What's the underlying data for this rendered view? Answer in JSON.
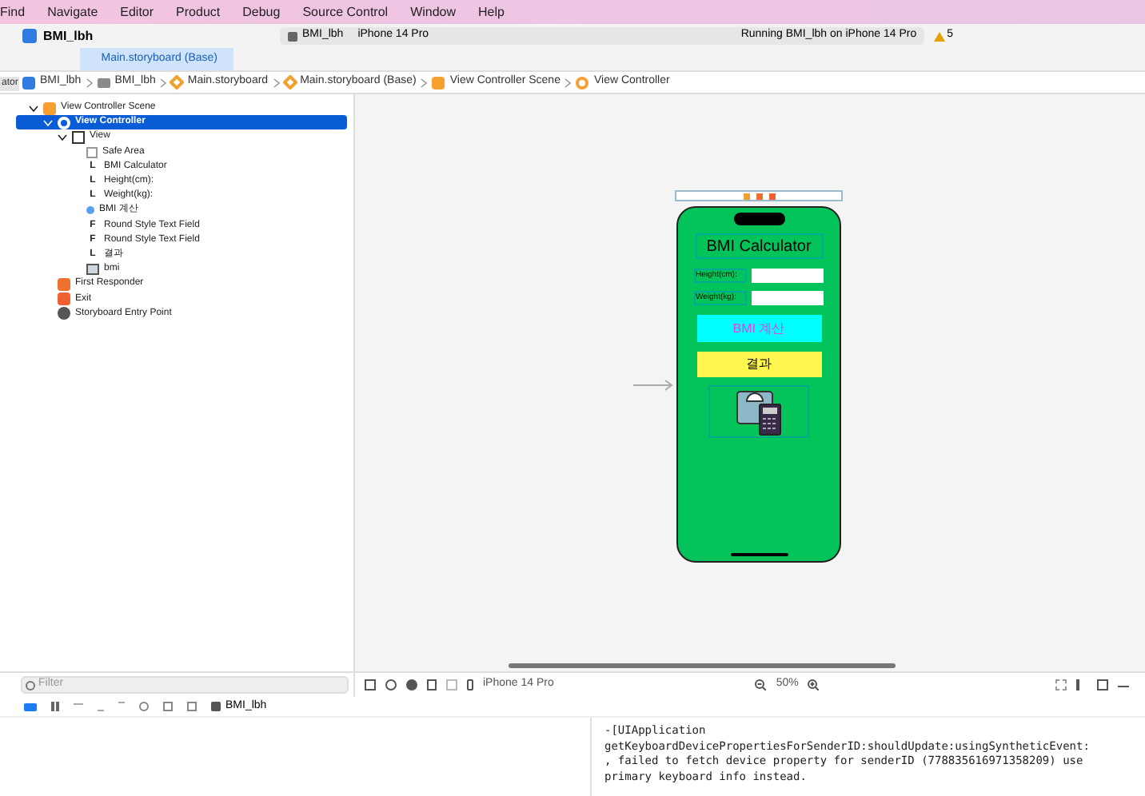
{
  "menu_bar": [
    "Find",
    "Navigate",
    "Editor",
    "Product",
    "Debug",
    "Source Control",
    "Window",
    "Help"
  ],
  "toolbar": {
    "project": "BMI_lbh",
    "scheme": "BMI_lbh",
    "device": "iPhone 14 Pro",
    "status": "Running BMI_lbh on iPhone 14 Pro",
    "warnings": "5"
  },
  "side_label": "ator",
  "tabs": [
    {
      "label": "Main.storyboard (Base)",
      "selected": true
    }
  ],
  "breadcrumbs": [
    {
      "label": "BMI_lbh",
      "kind": "project"
    },
    {
      "label": "BMI_lbh",
      "kind": "folder"
    },
    {
      "label": "Main.storyboard",
      "kind": "storyboard"
    },
    {
      "label": "Main.storyboard (Base)",
      "kind": "storyboard"
    },
    {
      "label": "View Controller Scene",
      "kind": "scene"
    },
    {
      "label": "View Controller",
      "kind": "controller"
    }
  ],
  "outline": [
    {
      "label": "View Controller Scene",
      "kind": "scene",
      "expanded": true,
      "selected": false,
      "children": [
        {
          "label": "View Controller",
          "kind": "controller",
          "expanded": true,
          "selected": true,
          "children": [
            {
              "label": "View",
              "kind": "view",
              "expanded": true,
              "selected": false,
              "children": [
                {
                  "label": "Safe Area",
                  "kind": "safe",
                  "selected": false
                },
                {
                  "label": "BMI Calculator",
                  "kind": "label",
                  "badge": "L",
                  "selected": false
                },
                {
                  "label": "Height(cm):",
                  "kind": "label",
                  "badge": "L",
                  "selected": false
                },
                {
                  "label": "Weight(kg):",
                  "kind": "label",
                  "badge": "L",
                  "selected": false
                },
                {
                  "label": "BMI 계산",
                  "kind": "button",
                  "selected": false
                },
                {
                  "label": "Round Style Text Field",
                  "kind": "field",
                  "badge": "F",
                  "selected": false
                },
                {
                  "label": "Round Style Text Field",
                  "kind": "field",
                  "badge": "F",
                  "selected": false
                },
                {
                  "label": "결과",
                  "kind": "label",
                  "badge": "L",
                  "selected": false
                },
                {
                  "label": "bmi",
                  "kind": "image",
                  "selected": false
                }
              ]
            }
          ]
        },
        {
          "label": "First Responder",
          "kind": "responder",
          "selected": false
        },
        {
          "label": "Exit",
          "kind": "exit",
          "selected": false
        },
        {
          "label": "Storyboard Entry Point",
          "kind": "entry",
          "selected": false
        }
      ]
    }
  ],
  "phone": {
    "title": "BMI Calculator",
    "height_label": "Height(cm):",
    "weight_label": "Weight(kg):",
    "button": "BMI 계산",
    "result": "결과"
  },
  "canvas_bar": {
    "device": "iPhone 14 Pro",
    "zoom": "50%"
  },
  "filter": {
    "placeholder": "Filter"
  },
  "debug_bar": {
    "target": "BMI_lbh"
  },
  "console": [
    "-[UIApplication",
    "getKeyboardDevicePropertiesForSenderID:shouldUpdate:usingSyntheticEvent:",
    ", failed to fetch device property for senderID (778835616971358209) use",
    "primary keyboard info instead."
  ]
}
